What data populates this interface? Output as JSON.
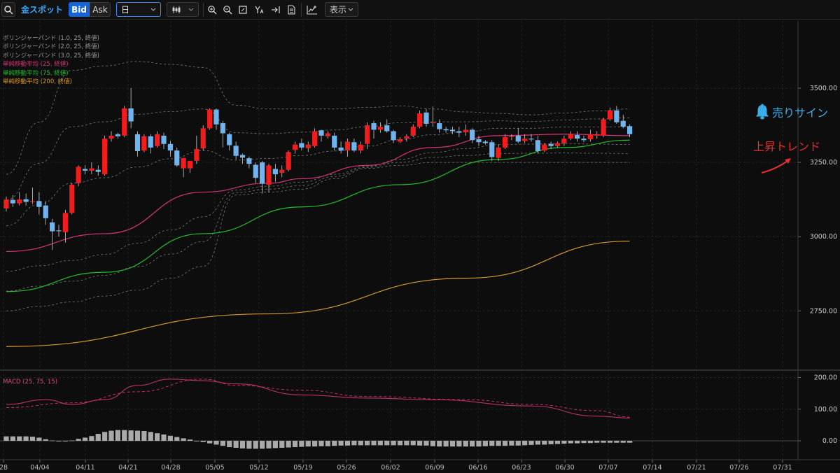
{
  "toolbar": {
    "symbol": "金スポット",
    "bid_label": "Bid",
    "ask_label": "Ask",
    "timeframe": "日",
    "display_label": "表示"
  },
  "legend": [
    {
      "text": "ボリンジャーバンド (1.0, 25, 終値)",
      "color": "#9a9a9a"
    },
    {
      "text": "ボリンジャーバンド (2.0, 25, 終値)",
      "color": "#9a9a9a"
    },
    {
      "text": "ボリンジャーバンド (3.0, 25, 終値)",
      "color": "#9a9a9a"
    },
    {
      "text": "単純移動平均 (25, 終値)",
      "color": "#d8337a"
    },
    {
      "text": "単純移動平均 (75, 終値)",
      "color": "#22c02a"
    },
    {
      "text": "単純移動平均 (200, 終値)",
      "color": "#d69a2a"
    }
  ],
  "macd_label": "MACD (25, 75, 15)",
  "annotations": {
    "sell_sign": "売りサイン",
    "uptrend": "上昇トレンド",
    "sell_color": "#3aaee8",
    "uptrend_color": "#e53030"
  },
  "colors": {
    "up": "#f21c1c",
    "down": "#6fb4ee",
    "sma25": "#d8337a",
    "sma75": "#22c02a",
    "sma200": "#d69a2a",
    "macd": "#c0306a",
    "histogram": "#a9a9a9"
  },
  "chart_data": [
    {
      "type": "candlestick",
      "title": "金スポット",
      "x_tick_labels": [
        "28",
        "04/04",
        "04/11",
        "04/21",
        "04/28",
        "05/05",
        "05/12",
        "05/19",
        "05/26",
        "06/02",
        "06/09",
        "06/16",
        "06/23",
        "06/30",
        "07/07",
        "07/14",
        "07/21",
        "07/26",
        "07/31"
      ],
      "y_tick_labels": [
        "3500.00",
        "3250.00",
        "3000.00",
        "2750.00"
      ],
      "ylim": [
        2580,
        3740
      ],
      "candles": [
        [
          3095,
          3125,
          3085,
          3135
        ],
        [
          3124,
          3112,
          3100,
          3140
        ],
        [
          3112,
          3125,
          3105,
          3150
        ],
        [
          3126,
          3117,
          3105,
          3145
        ],
        [
          3118,
          3120,
          3110,
          3165
        ],
        [
          3120,
          3100,
          3075,
          3150
        ],
        [
          3105,
          3062,
          3040,
          3120
        ],
        [
          3048,
          3018,
          2955,
          3060
        ],
        [
          3021,
          3020,
          3000,
          3040
        ],
        [
          3015,
          3080,
          2980,
          3090
        ],
        [
          3080,
          3175,
          3075,
          3180
        ],
        [
          3180,
          3235,
          3170,
          3240
        ],
        [
          3228,
          3222,
          3210,
          3240
        ],
        [
          3222,
          3230,
          3210,
          3250
        ],
        [
          3225,
          3218,
          3205,
          3240
        ],
        [
          3210,
          3330,
          3205,
          3340
        ],
        [
          3330,
          3340,
          3320,
          3355
        ],
        [
          3345,
          3338,
          3330,
          3350
        ],
        [
          3340,
          3432,
          3335,
          3440
        ],
        [
          3432,
          3388,
          3365,
          3500
        ],
        [
          3345,
          3288,
          3270,
          3355
        ],
        [
          3290,
          3338,
          3285,
          3345
        ],
        [
          3338,
          3300,
          3280,
          3345
        ],
        [
          3305,
          3345,
          3300,
          3355
        ],
        [
          3340,
          3312,
          3295,
          3350
        ],
        [
          3312,
          3290,
          3270,
          3322
        ],
        [
          3290,
          3240,
          3235,
          3300
        ],
        [
          3230,
          3265,
          3200,
          3265
        ],
        [
          3230,
          3255,
          3215,
          3255
        ],
        [
          3255,
          3295,
          3245,
          3340
        ],
        [
          3297,
          3365,
          3290,
          3375
        ],
        [
          3365,
          3428,
          3360,
          3432
        ],
        [
          3428,
          3378,
          3360,
          3432
        ],
        [
          3382,
          3348,
          3300,
          3390
        ],
        [
          3345,
          3308,
          3290,
          3350
        ],
        [
          3306,
          3272,
          3260,
          3320
        ],
        [
          3275,
          3266,
          3245,
          3280
        ],
        [
          3264,
          3245,
          3230,
          3270
        ],
        [
          3242,
          3198,
          3180,
          3250
        ],
        [
          3250,
          3178,
          3145,
          3255
        ],
        [
          3175,
          3240,
          3150,
          3245
        ],
        [
          3228,
          3210,
          3185,
          3245
        ],
        [
          3215,
          3225,
          3200,
          3240
        ],
        [
          3225,
          3285,
          3220,
          3290
        ],
        [
          3292,
          3310,
          3280,
          3320
        ],
        [
          3315,
          3300,
          3290,
          3330
        ],
        [
          3298,
          3310,
          3285,
          3320
        ],
        [
          3305,
          3355,
          3300,
          3365
        ],
        [
          3358,
          3340,
          3320,
          3360
        ],
        [
          3338,
          3348,
          3330,
          3355
        ],
        [
          3340,
          3300,
          3290,
          3350
        ],
        [
          3300,
          3290,
          3280,
          3320
        ],
        [
          3290,
          3320,
          3270,
          3330
        ],
        [
          3318,
          3290,
          3285,
          3330
        ],
        [
          3290,
          3310,
          3280,
          3320
        ],
        [
          3312,
          3375,
          3295,
          3385
        ],
        [
          3382,
          3360,
          3330,
          3390
        ],
        [
          3360,
          3370,
          3350,
          3385
        ],
        [
          3375,
          3355,
          3350,
          3395
        ],
        [
          3355,
          3325,
          3315,
          3360
        ],
        [
          3320,
          3328,
          3315,
          3335
        ],
        [
          3330,
          3338,
          3320,
          3345
        ],
        [
          3340,
          3370,
          3335,
          3378
        ],
        [
          3370,
          3415,
          3365,
          3425
        ],
        [
          3418,
          3380,
          3370,
          3430
        ],
        [
          3382,
          3385,
          3370,
          3438
        ],
        [
          3382,
          3362,
          3350,
          3395
        ],
        [
          3362,
          3358,
          3350,
          3370
        ],
        [
          3360,
          3355,
          3345,
          3370
        ],
        [
          3355,
          3350,
          3335,
          3370
        ],
        [
          3352,
          3360,
          3340,
          3378
        ],
        [
          3360,
          3325,
          3315,
          3365
        ],
        [
          3328,
          3318,
          3305,
          3340
        ],
        [
          3320,
          3315,
          3310,
          3325
        ],
        [
          3318,
          3268,
          3255,
          3325
        ],
        [
          3265,
          3300,
          3255,
          3310
        ],
        [
          3300,
          3335,
          3295,
          3345
        ],
        [
          3335,
          3338,
          3325,
          3345
        ],
        [
          3340,
          3320,
          3315,
          3365
        ],
        [
          3322,
          3330,
          3315,
          3345
        ],
        [
          3330,
          3328,
          3320,
          3345
        ],
        [
          3325,
          3288,
          3280,
          3340
        ],
        [
          3290,
          3310,
          3285,
          3315
        ],
        [
          3312,
          3305,
          3295,
          3320
        ],
        [
          3305,
          3315,
          3300,
          3320
        ],
        [
          3315,
          3330,
          3305,
          3340
        ],
        [
          3330,
          3345,
          3325,
          3355
        ],
        [
          3342,
          3330,
          3320,
          3355
        ],
        [
          3330,
          3325,
          3318,
          3340
        ],
        [
          3328,
          3345,
          3320,
          3360
        ],
        [
          3340,
          3345,
          3330,
          3355
        ],
        [
          3340,
          3395,
          3335,
          3400
        ],
        [
          3395,
          3425,
          3390,
          3435
        ],
        [
          3425,
          3385,
          3380,
          3440
        ],
        [
          3390,
          3370,
          3365,
          3410
        ],
        [
          3372,
          3345,
          3335,
          3378
        ]
      ],
      "sma25_approx": [
        [
          0,
          2950
        ],
        [
          15,
          3010
        ],
        [
          30,
          3150
        ],
        [
          40,
          3180
        ],
        [
          45,
          3195
        ],
        [
          55,
          3240
        ],
        [
          65,
          3300
        ],
        [
          75,
          3340
        ],
        [
          85,
          3345
        ],
        [
          95,
          3340
        ]
      ],
      "sma75_approx": [
        [
          0,
          2815
        ],
        [
          15,
          2880
        ],
        [
          30,
          3010
        ],
        [
          45,
          3100
        ],
        [
          60,
          3175
        ],
        [
          75,
          3260
        ],
        [
          85,
          3300
        ],
        [
          95,
          3325
        ]
      ],
      "sma200_approx": [
        [
          0,
          2630
        ],
        [
          40,
          2740
        ],
        [
          70,
          2860
        ],
        [
          95,
          2985
        ]
      ],
      "bollinger_upper3_approx": [
        [
          0,
          3210
        ],
        [
          10,
          3560
        ],
        [
          20,
          3590
        ],
        [
          30,
          3570
        ],
        [
          32,
          3450
        ],
        [
          40,
          3430
        ],
        [
          50,
          3430
        ],
        [
          60,
          3440
        ],
        [
          70,
          3420
        ],
        [
          80,
          3410
        ],
        [
          95,
          3430
        ]
      ],
      "bollinger_lower3_approx": [
        [
          0,
          2750
        ],
        [
          10,
          2780
        ],
        [
          20,
          2820
        ],
        [
          30,
          2900
        ],
        [
          35,
          3140
        ],
        [
          45,
          3160
        ],
        [
          55,
          3230
        ],
        [
          65,
          3250
        ],
        [
          75,
          3250
        ],
        [
          85,
          3250
        ],
        [
          95,
          3250
        ]
      ]
    },
    {
      "type": "bar",
      "title": "MACD (25, 75, 15)",
      "y_tick_labels": [
        "200.00",
        "100.00",
        "0.00"
      ],
      "ylim": [
        -30,
        210
      ],
      "histogram": [
        14,
        14,
        14,
        14,
        13,
        10,
        5,
        1,
        -2,
        -2,
        1,
        6,
        10,
        15,
        22,
        28,
        32,
        34,
        34,
        33,
        32,
        31,
        28,
        24,
        20,
        16,
        12,
        8,
        4,
        0,
        -4,
        -8,
        -12,
        -16,
        -20,
        -22,
        -24,
        -25,
        -25,
        -25,
        -24,
        -23,
        -22,
        -21,
        -20,
        -19,
        -18,
        -18,
        -17,
        -17,
        -16,
        -15,
        -15,
        -14,
        -14,
        -14,
        -14,
        -14,
        -14,
        -14,
        -14,
        -14,
        -14,
        -15,
        -15,
        -17,
        -18,
        -18,
        -18,
        -18,
        -18,
        -18,
        -18,
        -17,
        -16,
        -16,
        -16,
        -15,
        -15,
        -14,
        -13,
        -12,
        -12,
        -11,
        -10,
        -9,
        -8,
        -8,
        -7,
        -7,
        -6,
        -6,
        -6,
        -6,
        -6,
        -6
      ],
      "macd_line_approx": [
        [
          0,
          115
        ],
        [
          6,
          130
        ],
        [
          10,
          115
        ],
        [
          15,
          130
        ],
        [
          20,
          175
        ],
        [
          25,
          195
        ],
        [
          30,
          190
        ],
        [
          35,
          180
        ],
        [
          45,
          145
        ],
        [
          55,
          135
        ],
        [
          65,
          130
        ],
        [
          80,
          110
        ],
        [
          90,
          78
        ],
        [
          95,
          72
        ]
      ],
      "signal_line_approx": [
        [
          0,
          105
        ],
        [
          10,
          120
        ],
        [
          20,
          155
        ],
        [
          30,
          195
        ],
        [
          35,
          175
        ],
        [
          45,
          160
        ],
        [
          55,
          140
        ],
        [
          70,
          130
        ],
        [
          80,
          115
        ],
        [
          90,
          95
        ],
        [
          95,
          75
        ]
      ]
    }
  ]
}
